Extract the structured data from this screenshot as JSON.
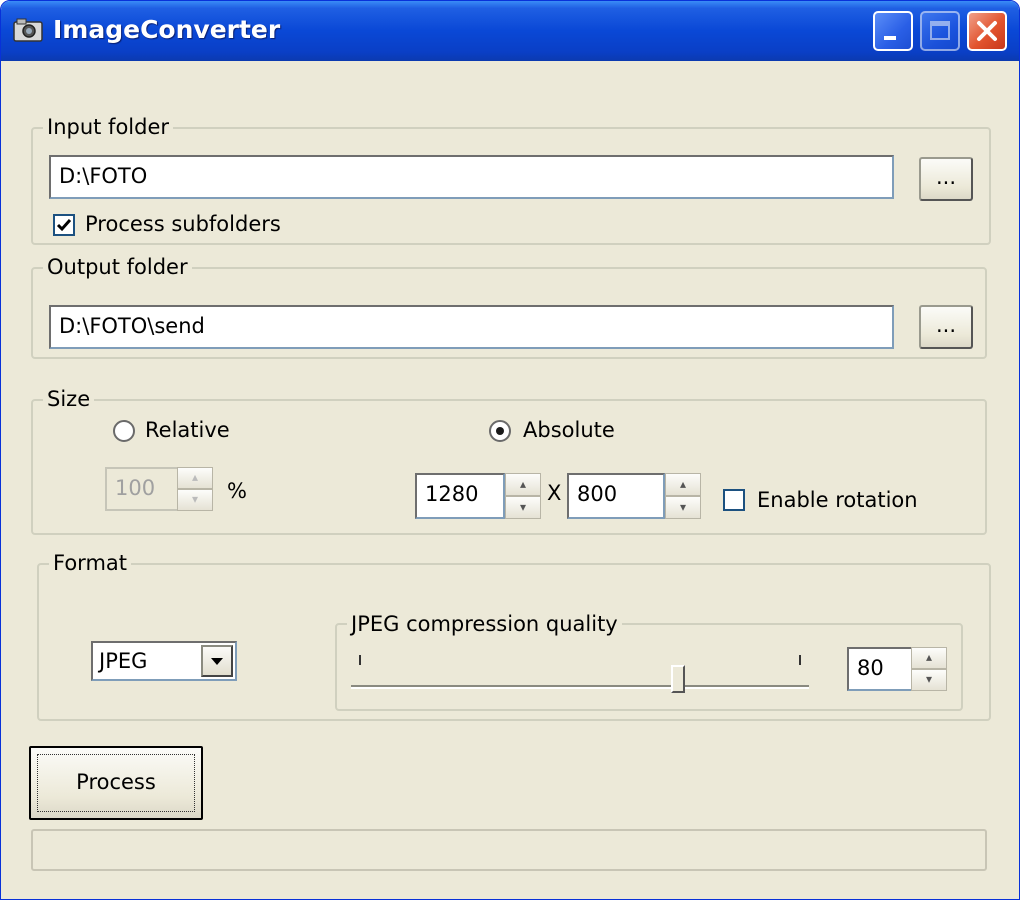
{
  "window": {
    "title": "ImageConverter"
  },
  "input_folder": {
    "legend": "Input folder",
    "path": "D:\\FOTO",
    "browse_label": "...",
    "subfolders_label": "Process subfolders",
    "subfolders_checked": true
  },
  "output_folder": {
    "legend": "Output folder",
    "path": "D:\\FOTO\\send",
    "browse_label": "..."
  },
  "size": {
    "legend": "Size",
    "relative_label": "Relative",
    "absolute_label": "Absolute",
    "selected": "Absolute",
    "percent_value": "100",
    "percent_unit": "%",
    "width": "1280",
    "separator": "X",
    "height": "800",
    "rotation_label": "Enable rotation",
    "rotation_checked": false
  },
  "format": {
    "legend": "Format",
    "selected": "JPEG",
    "quality_legend": "JPEG compression quality",
    "quality_value": "80",
    "quality_fraction": 0.72
  },
  "actions": {
    "process_label": "Process"
  },
  "progress": {
    "fraction": 0
  },
  "icons": {
    "app": "camera-icon",
    "minimize": "minimize-icon",
    "maximize": "maximize-icon",
    "close": "close-icon"
  },
  "colors": {
    "titlebar": "#0a48d6",
    "window_bg": "#ece9d8",
    "close_button": "#e2542f"
  }
}
